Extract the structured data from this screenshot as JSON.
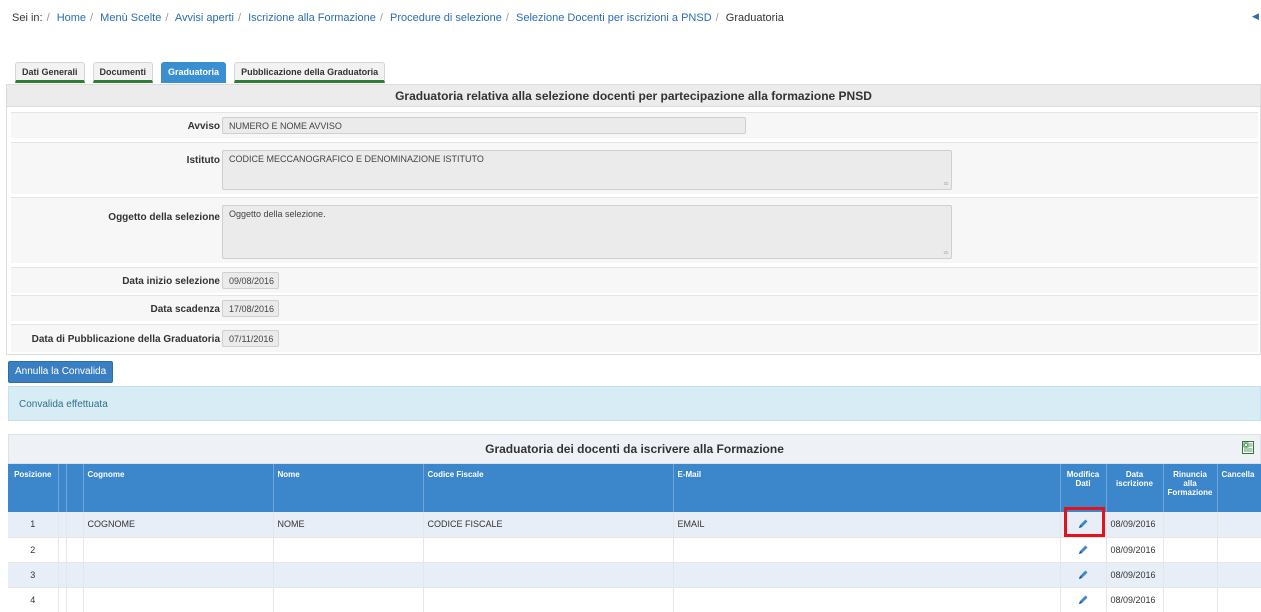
{
  "breadcrumb": {
    "prefix": "Sei in:",
    "items": [
      "Home",
      "Menù Scelte",
      "Avvisi aperti",
      "Iscrizione alla Formazione",
      "Procedure di selezione",
      "Selezione Docenti per iscrizioni a PNSD"
    ],
    "current": "Graduatoria"
  },
  "tabs": [
    {
      "label": "Dati Generali",
      "active": false
    },
    {
      "label": "Documenti",
      "active": false
    },
    {
      "label": "Graduatoria",
      "active": true
    },
    {
      "label": "Pubblicazione della Graduatoria",
      "active": false
    }
  ],
  "panel": {
    "title": "Graduatoria relativa alla selezione docenti per partecipazione alla formazione PNSD",
    "fields": {
      "avviso": {
        "label": "Avviso",
        "value": "NUMERO E NOME AVVISO"
      },
      "istituto": {
        "label": "Istituto",
        "value": "CODICE MECCANOGRAFICO E DENOMINAZIONE ISTITUTO"
      },
      "oggetto": {
        "label": "Oggetto della selezione",
        "value": "Oggetto della selezione."
      },
      "data_inizio": {
        "label": "Data inizio selezione",
        "value": "09/08/2016"
      },
      "data_scadenza": {
        "label": "Data scadenza",
        "value": "17/08/2016"
      },
      "data_pubblicazione": {
        "label": "Data di Pubblicazione della Graduatoria",
        "value": "07/11/2016"
      }
    }
  },
  "actions": {
    "annulla_label": "Annulla la Convalida"
  },
  "alert": {
    "text": "Convalida effettuata"
  },
  "table": {
    "title": "Graduatoria dei docenti da iscrivere alla Formazione",
    "columns": {
      "posizione": "Posizione",
      "cognome": "Cognome",
      "nome": "Nome",
      "codice_fiscale": "Codice Fiscale",
      "email": "E-Mail",
      "modifica": "Modifica Dati",
      "data_iscrizione": "Data iscrizione",
      "rinuncia": "Rinuncia alla Formazione",
      "cancella": "Cancella"
    },
    "rows": [
      {
        "pos": "1",
        "cognome": "COGNOME",
        "nome": "NOME",
        "cf": "CODICE FISCALE",
        "email": "EMAIL",
        "data": "08/09/2016"
      },
      {
        "pos": "2",
        "cognome": "",
        "nome": "",
        "cf": "",
        "email": "",
        "data": "08/09/2016"
      },
      {
        "pos": "3",
        "cognome": "",
        "nome": "",
        "cf": "",
        "email": "",
        "data": "08/09/2016"
      },
      {
        "pos": "4",
        "cognome": "",
        "nome": "",
        "cf": "",
        "email": "",
        "data": "08/09/2016"
      }
    ]
  },
  "colors": {
    "header_blue": "#3c86cc",
    "tab_active": "#3a8fd1",
    "tab_underline": "#2e7d32",
    "highlight_red": "#e0141a",
    "alert_bg": "#d7ecf4"
  },
  "icons": {
    "edit": "pencil-icon",
    "export": "excel-icon",
    "back": "back-arrow-icon"
  }
}
